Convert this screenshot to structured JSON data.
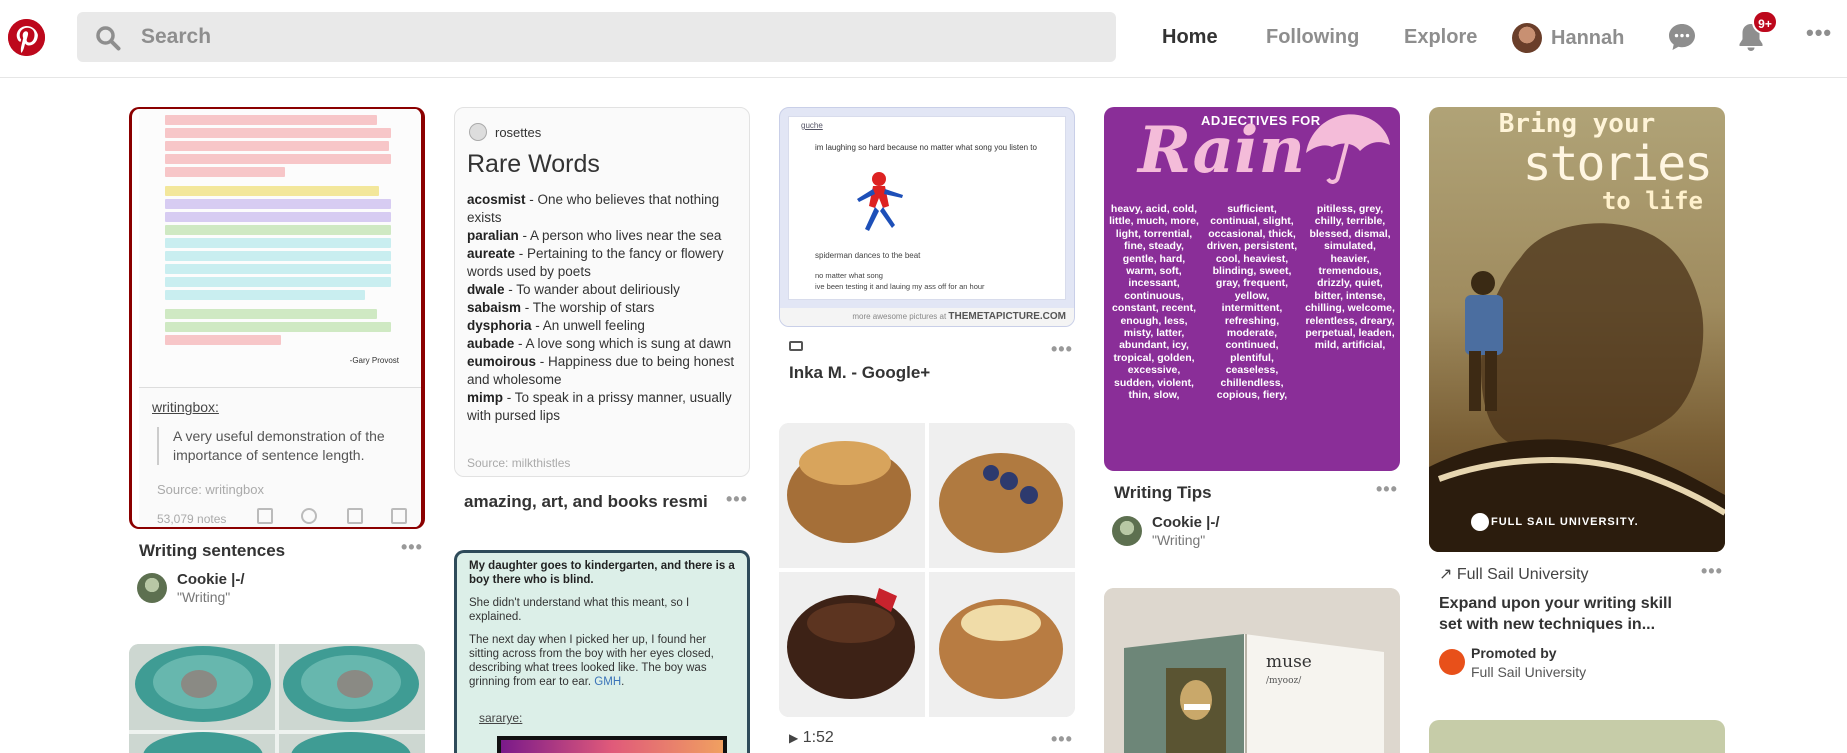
{
  "header": {
    "search_placeholder": "Search",
    "nav": {
      "home": "Home",
      "following": "Following",
      "explore": "Explore"
    },
    "user_name": "Hannah",
    "notification_badge": "9+",
    "more": "•••"
  },
  "pins": {
    "writing": {
      "title": "Writing sentences",
      "more": "•••",
      "quote_author": "-Gary Provost",
      "tumblr_user": "writingbox:",
      "tumblr_quote": "A very useful demonstration of the importance of sentence length.",
      "tumblr_source": "Source: writingbox",
      "notes": "53,079 notes",
      "pinner": "Cookie |-/",
      "board": "\"Writing\""
    },
    "rarewords": {
      "poster": "rosettes",
      "heading": "Rare Words",
      "entries": [
        {
          "word": "acosmist",
          "def": " - One who believes that nothing exists"
        },
        {
          "word": "paralian",
          "def": " - A person who lives near the sea"
        },
        {
          "word": "aureate",
          "def": " - Pertaining to the fancy or flowery words used by poets"
        },
        {
          "word": "dwale",
          "def": " - To wander about deliriously"
        },
        {
          "word": "sabaism",
          "def": " - The worship of stars"
        },
        {
          "word": "dysphoria",
          "def": " - An unwell feeling"
        },
        {
          "word": "aubade",
          "def": " - A love song which is sung at dawn"
        },
        {
          "word": "eumoirous",
          "def": " - Happiness due to being honest and wholesome"
        },
        {
          "word": "mimp",
          "def": " - To speak in a prissy manner, usually with pursed lips"
        }
      ],
      "source": "Source: milkthistles",
      "title": "amazing, art, and books resmi",
      "more": "•••"
    },
    "spider": {
      "user": "guche",
      "line1": "im laughing so hard because no matter what song you listen to",
      "line2": "spiderman dances to the beat",
      "line3": "no matter what song",
      "line4": "ive been testing it and lauing my ass off for an hour",
      "footer": "more awesome pictures at",
      "footer_site": "THEMETAPICTURE.COM",
      "title": "Inka M. - Google+",
      "more": "•••"
    },
    "rain": {
      "heading": "ADJECTIVES FOR",
      "word": "Rain",
      "col1": "heavy, acid, cold, little, much, more, light, torrential, fine, steady, gentle, hard, warm, soft, incessant, continuous, constant, recent, enough, less, misty, latter, abundant, icy, tropical, golden, excessive, sudden, violent, thin, slow,",
      "col2": "sufficient, continual, slight, occasional, thick, driven, persistent, cool, heaviest, blinding, sweet, gray, frequent, yellow, intermittent, refreshing, moderate, continued, plentiful, ceaseless, chillendless, copious, fiery,",
      "col3": "pitiless, grey, chilly, terrible, blessed, dismal, simulated, heavier, tremendous, drizzly, quiet, bitter, intense, chilling, welcome, relentless, dreary, perpetual, leaden, mild, artificial,",
      "title": "Writing Tips",
      "more": "•••",
      "pinner": "Cookie |-/",
      "board": "\"Writing\""
    },
    "fullsail": {
      "line1": "Bring your",
      "line2": "stories",
      "line3": "to life",
      "brand": "FULL SAIL UNIVERSITY.",
      "link": "Full Sail University",
      "more": "•••",
      "headline": "Expand upon your writing skill set with new techniques in...",
      "promoted_by": "Promoted by",
      "promoter": "Full Sail University"
    },
    "kinder": {
      "bold": "My daughter goes to kindergarten, and there is a boy there who is blind.",
      "p2": "She didn't understand what this meant, so I explained.",
      "p3": "The next day when I picked her up, I found her sitting across from the boy with her eyes closed, describing what trees looked like. The boy was grinning from ear to ear.",
      "tag": "GMH",
      "user": "sararye:"
    },
    "pancake": {
      "duration": "1:52",
      "more": "•••"
    },
    "muse": {
      "word": "muse",
      "pron": "/myooz/"
    }
  }
}
